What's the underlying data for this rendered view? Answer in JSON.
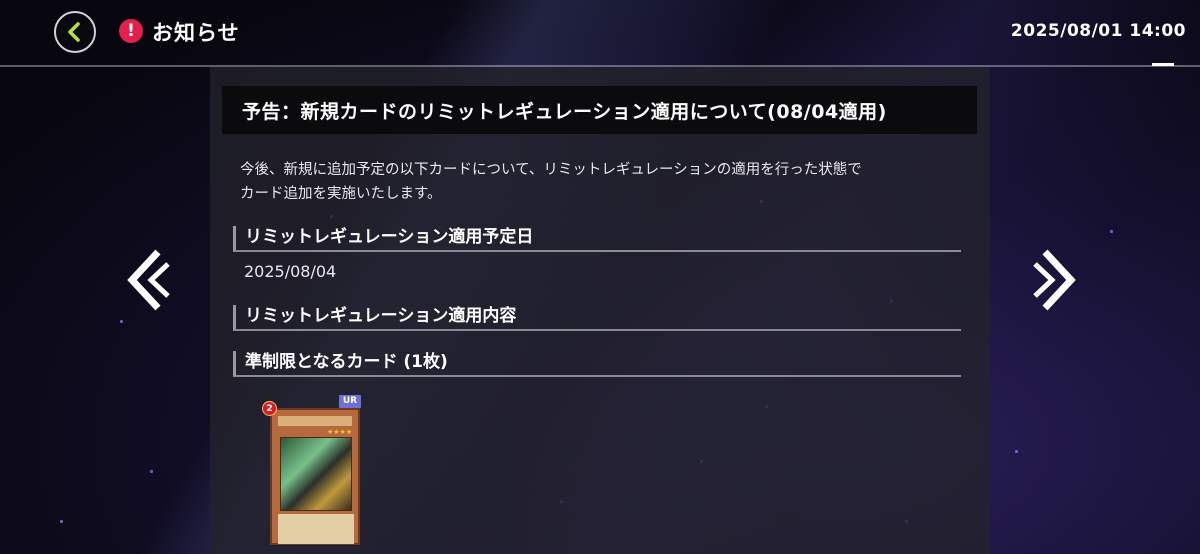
{
  "header": {
    "title": "お知らせ",
    "datetime": "2025/08/01 14:00",
    "notice_icon_glyph": "!"
  },
  "notice": {
    "headline": "予告：新規カードのリミットレギュレーション適用について(08/04適用)",
    "body_line1": "今後、新規に追加予定の以下カードについて、リミットレギュレーションの適用を行った状態で",
    "body_line2": "カード追加を実施いたします。",
    "sections": [
      {
        "label": "リミットレギュレーション適用予定日"
      },
      {
        "label": "リミットレギュレーション適用内容"
      },
      {
        "label": "準制限となるカード (1枚)"
      }
    ],
    "apply_date": "2025/08/04"
  },
  "card": {
    "rarity": "UR",
    "limit_count": "2",
    "stars": "★★★★"
  },
  "colors": {
    "accent_back_arrow": "#b6e33a",
    "notice_red": "#e2204c",
    "rarity_badge": "#6f6fd8"
  },
  "icons": {
    "back": "chevron-left-icon",
    "prev": "double-chevron-left-icon",
    "next": "double-chevron-right-icon",
    "notice": "exclamation-icon"
  }
}
